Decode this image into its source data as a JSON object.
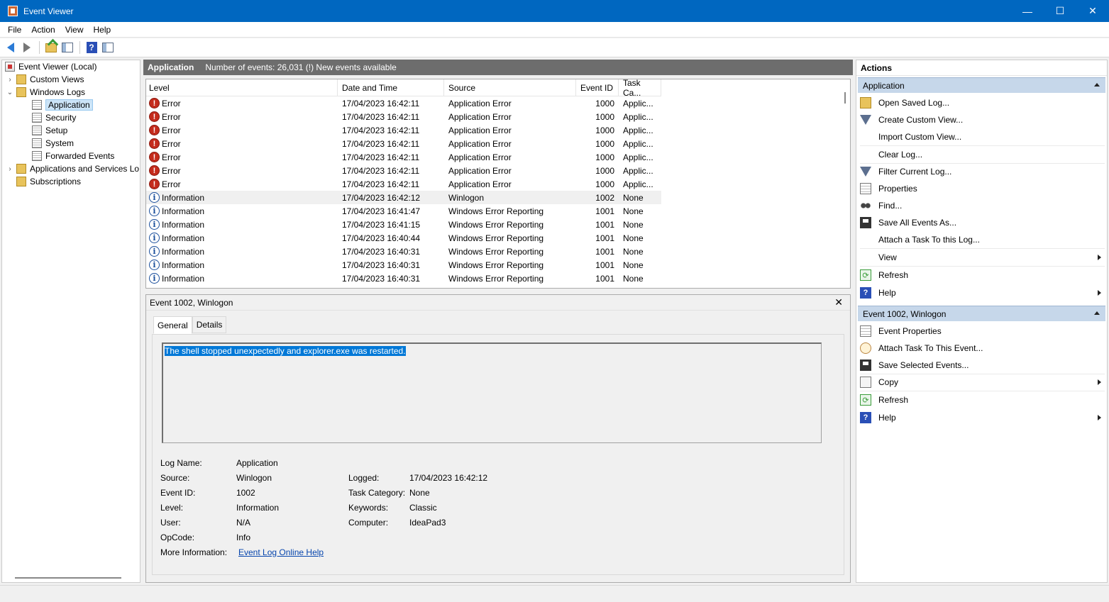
{
  "window": {
    "title": "Event Viewer",
    "app_icon": "event-viewer-icon",
    "minimize_glyph": "—",
    "maximize_glyph": "☐",
    "close_glyph": "✕"
  },
  "menu": {
    "file": "File",
    "action": "Action",
    "view": "View",
    "help": "Help"
  },
  "toolbar": {
    "icons": [
      "back-arrow-icon",
      "forward-arrow-icon",
      "up-folder-icon",
      "show-hide-tree-icon",
      "help-icon",
      "show-hide-action-pane-icon"
    ]
  },
  "tree": {
    "root": "Event Viewer (Local)",
    "custom_views": "Custom Views",
    "windows_logs": "Windows Logs",
    "application": "Application",
    "security": "Security",
    "setup": "Setup",
    "system": "System",
    "forwarded_events": "Forwarded Events",
    "apps_services": "Applications and Services Lo",
    "subscriptions": "Subscriptions"
  },
  "center": {
    "title": "Application",
    "event_count": "Number of events: 26,031 (!) New events available",
    "columns": {
      "level": "Level",
      "date": "Date and Time",
      "source": "Source",
      "event_id": "Event ID",
      "task": "Task Ca..."
    },
    "rows": [
      {
        "level": "Error",
        "type": "error",
        "date": "17/04/2023 16:42:11",
        "source": "Application Error",
        "event_id": "1000",
        "task": "Applic..."
      },
      {
        "level": "Error",
        "type": "error",
        "date": "17/04/2023 16:42:11",
        "source": "Application Error",
        "event_id": "1000",
        "task": "Applic..."
      },
      {
        "level": "Error",
        "type": "error",
        "date": "17/04/2023 16:42:11",
        "source": "Application Error",
        "event_id": "1000",
        "task": "Applic..."
      },
      {
        "level": "Error",
        "type": "error",
        "date": "17/04/2023 16:42:11",
        "source": "Application Error",
        "event_id": "1000",
        "task": "Applic..."
      },
      {
        "level": "Error",
        "type": "error",
        "date": "17/04/2023 16:42:11",
        "source": "Application Error",
        "event_id": "1000",
        "task": "Applic..."
      },
      {
        "level": "Error",
        "type": "error",
        "date": "17/04/2023 16:42:11",
        "source": "Application Error",
        "event_id": "1000",
        "task": "Applic..."
      },
      {
        "level": "Error",
        "type": "error",
        "date": "17/04/2023 16:42:11",
        "source": "Application Error",
        "event_id": "1000",
        "task": "Applic..."
      },
      {
        "level": "Information",
        "type": "info",
        "date": "17/04/2023 16:42:12",
        "source": "Winlogon",
        "event_id": "1002",
        "task": "None",
        "selected": true
      },
      {
        "level": "Information",
        "type": "info",
        "date": "17/04/2023 16:41:47",
        "source": "Windows Error Reporting",
        "event_id": "1001",
        "task": "None"
      },
      {
        "level": "Information",
        "type": "info",
        "date": "17/04/2023 16:41:15",
        "source": "Windows Error Reporting",
        "event_id": "1001",
        "task": "None"
      },
      {
        "level": "Information",
        "type": "info",
        "date": "17/04/2023 16:40:44",
        "source": "Windows Error Reporting",
        "event_id": "1001",
        "task": "None"
      },
      {
        "level": "Information",
        "type": "info",
        "date": "17/04/2023 16:40:31",
        "source": "Windows Error Reporting",
        "event_id": "1001",
        "task": "None"
      },
      {
        "level": "Information",
        "type": "info",
        "date": "17/04/2023 16:40:31",
        "source": "Windows Error Reporting",
        "event_id": "1001",
        "task": "None"
      },
      {
        "level": "Information",
        "type": "info",
        "date": "17/04/2023 16:40:31",
        "source": "Windows Error Reporting",
        "event_id": "1001",
        "task": "None"
      }
    ]
  },
  "detail": {
    "title": "Event 1002, Winlogon",
    "close_glyph": "✕",
    "tabs": {
      "general": "General",
      "details": "Details"
    },
    "message": "The shell stopped unexpectedly and explorer.exe was restarted.",
    "labels": {
      "log_name": "Log Name:",
      "source": "Source:",
      "event_id": "Event ID:",
      "level": "Level:",
      "user": "User:",
      "opcode": "OpCode:",
      "more_info": "More Information:",
      "logged": "Logged:",
      "task_category": "Task Category:",
      "keywords": "Keywords:",
      "computer": "Computer:"
    },
    "values": {
      "log_name": "Application",
      "source": "Winlogon",
      "event_id": "1002",
      "level": "Information",
      "user": "N/A",
      "opcode": "Info",
      "more_info": "Event Log Online Help",
      "logged": "17/04/2023 16:42:12",
      "task_category": "None",
      "keywords": "Classic",
      "computer": "IdeaPad3"
    }
  },
  "actions": {
    "title": "Actions",
    "section_app": "Application",
    "app_items": {
      "open_saved": "Open Saved Log...",
      "create_custom": "Create Custom View...",
      "import_custom": "Import Custom View...",
      "clear_log": "Clear Log...",
      "filter": "Filter Current Log...",
      "properties": "Properties",
      "find": "Find...",
      "save_all": "Save All Events As...",
      "attach_task": "Attach a Task To this Log...",
      "view": "View",
      "refresh": "Refresh",
      "help": "Help"
    },
    "section_event": "Event 1002, Winlogon",
    "event_items": {
      "event_properties": "Event Properties",
      "attach_task": "Attach Task To This Event...",
      "save_selected": "Save Selected Events...",
      "copy": "Copy",
      "refresh": "Refresh",
      "help": "Help"
    }
  },
  "glyphs": {
    "expand": "›",
    "collapse": "⌄",
    "error": "!",
    "info": "i",
    "help": "?",
    "refresh": "⟳"
  },
  "colors": {
    "titlebar": "#0067c0",
    "section_header": "#c6d7ea",
    "center_header": "#6d6d6d",
    "selection": "#0078d7"
  }
}
